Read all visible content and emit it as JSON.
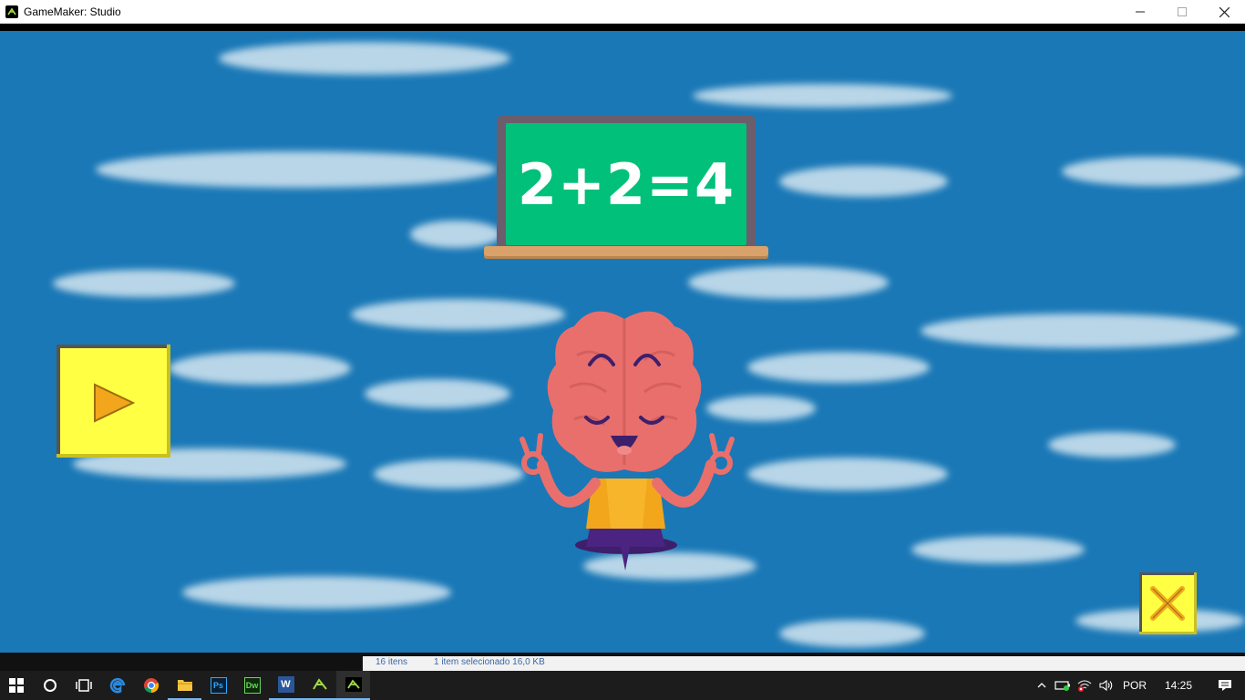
{
  "window": {
    "title": "GameMaker: Studio",
    "controls": {
      "minimize": "—",
      "maximize": "☐",
      "close": "✕"
    }
  },
  "game": {
    "chalkboard_text": "2+2=4",
    "buttons": {
      "play": "play-icon",
      "close": "close-x-icon"
    },
    "colors": {
      "sky": "#1a78b6",
      "board": "#00c07a",
      "button": "#ffff44",
      "brain": "#e96f6c"
    }
  },
  "explorer_strip": {
    "items_text": "16 itens",
    "selected_text": "1 item selecionado  16,0 KB"
  },
  "taskbar": {
    "apps": [
      "start-icon",
      "cortana-icon",
      "task-view-icon",
      "edge-icon",
      "chrome-icon",
      "file-explorer-icon",
      "photoshop-icon",
      "dreamweaver-icon",
      "word-icon",
      "gamemaker-icon",
      "gamemaker-runner-icon"
    ],
    "photoshop_label": "Ps",
    "dreamweaver_label": "Dw",
    "word_label": "W",
    "tray": {
      "language": "POR",
      "time": "14:25"
    }
  }
}
